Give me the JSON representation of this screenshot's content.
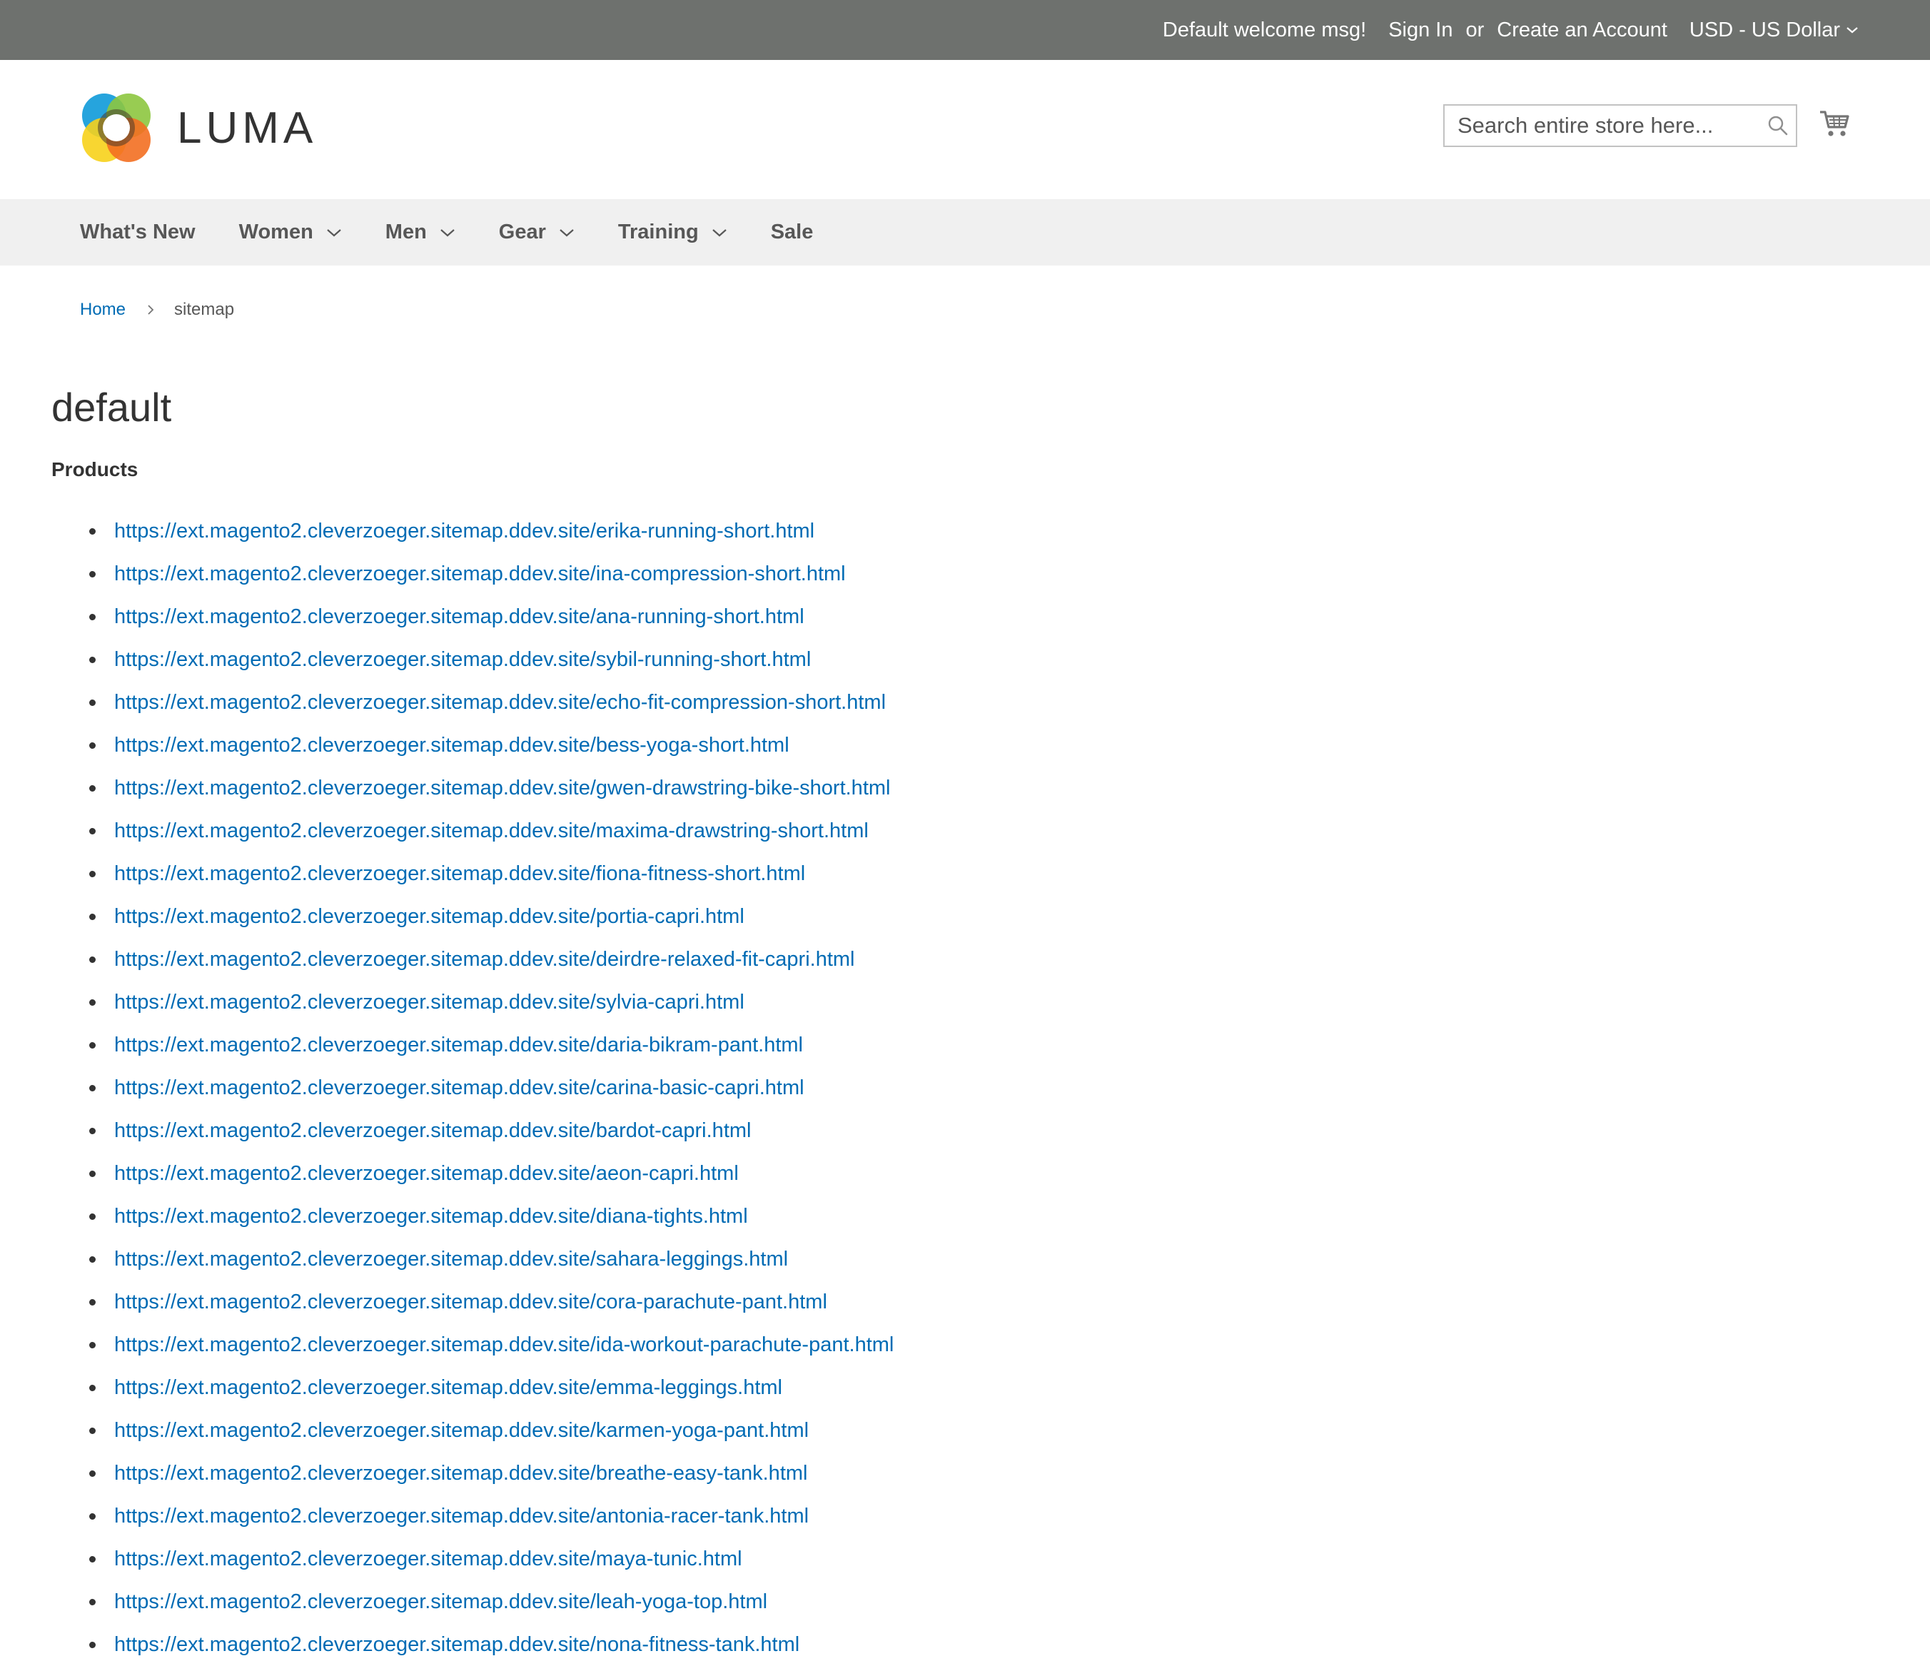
{
  "top_bar": {
    "welcome": "Default welcome msg!",
    "sign_in": "Sign In",
    "or": "or",
    "create_account": "Create an Account",
    "currency": "USD - US Dollar",
    "background": "#6e716e"
  },
  "header": {
    "logo_text": "LUMA",
    "search_placeholder": "Search entire store here...",
    "search_icon": "search-icon",
    "cart_icon": "cart-icon"
  },
  "nav": {
    "items": [
      {
        "label": "What's New",
        "has_dropdown": false
      },
      {
        "label": "Women",
        "has_dropdown": true
      },
      {
        "label": "Men",
        "has_dropdown": true
      },
      {
        "label": "Gear",
        "has_dropdown": true
      },
      {
        "label": "Training",
        "has_dropdown": true
      },
      {
        "label": "Sale",
        "has_dropdown": false
      }
    ]
  },
  "breadcrumb": {
    "home": "Home",
    "current": "sitemap"
  },
  "main": {
    "title": "default",
    "section_title": "Products",
    "links": [
      "https://ext.magento2.cleverzoeger.sitemap.ddev.site/erika-running-short.html",
      "https://ext.magento2.cleverzoeger.sitemap.ddev.site/ina-compression-short.html",
      "https://ext.magento2.cleverzoeger.sitemap.ddev.site/ana-running-short.html",
      "https://ext.magento2.cleverzoeger.sitemap.ddev.site/sybil-running-short.html",
      "https://ext.magento2.cleverzoeger.sitemap.ddev.site/echo-fit-compression-short.html",
      "https://ext.magento2.cleverzoeger.sitemap.ddev.site/bess-yoga-short.html",
      "https://ext.magento2.cleverzoeger.sitemap.ddev.site/gwen-drawstring-bike-short.html",
      "https://ext.magento2.cleverzoeger.sitemap.ddev.site/maxima-drawstring-short.html",
      "https://ext.magento2.cleverzoeger.sitemap.ddev.site/fiona-fitness-short.html",
      "https://ext.magento2.cleverzoeger.sitemap.ddev.site/portia-capri.html",
      "https://ext.magento2.cleverzoeger.sitemap.ddev.site/deirdre-relaxed-fit-capri.html",
      "https://ext.magento2.cleverzoeger.sitemap.ddev.site/sylvia-capri.html",
      "https://ext.magento2.cleverzoeger.sitemap.ddev.site/daria-bikram-pant.html",
      "https://ext.magento2.cleverzoeger.sitemap.ddev.site/carina-basic-capri.html",
      "https://ext.magento2.cleverzoeger.sitemap.ddev.site/bardot-capri.html",
      "https://ext.magento2.cleverzoeger.sitemap.ddev.site/aeon-capri.html",
      "https://ext.magento2.cleverzoeger.sitemap.ddev.site/diana-tights.html",
      "https://ext.magento2.cleverzoeger.sitemap.ddev.site/sahara-leggings.html",
      "https://ext.magento2.cleverzoeger.sitemap.ddev.site/cora-parachute-pant.html",
      "https://ext.magento2.cleverzoeger.sitemap.ddev.site/ida-workout-parachute-pant.html",
      "https://ext.magento2.cleverzoeger.sitemap.ddev.site/emma-leggings.html",
      "https://ext.magento2.cleverzoeger.sitemap.ddev.site/karmen-yoga-pant.html",
      "https://ext.magento2.cleverzoeger.sitemap.ddev.site/breathe-easy-tank.html",
      "https://ext.magento2.cleverzoeger.sitemap.ddev.site/antonia-racer-tank.html",
      "https://ext.magento2.cleverzoeger.sitemap.ddev.site/maya-tunic.html",
      "https://ext.magento2.cleverzoeger.sitemap.ddev.site/leah-yoga-top.html",
      "https://ext.magento2.cleverzoeger.sitemap.ddev.site/nona-fitness-tank.html"
    ]
  },
  "colors": {
    "link": "#006bb4",
    "nav_background": "#f0f0f0",
    "text": "#333333"
  }
}
